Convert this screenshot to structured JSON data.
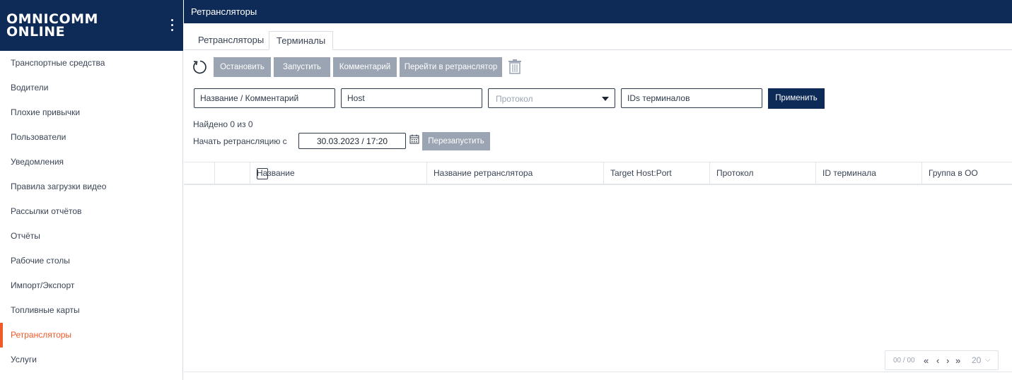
{
  "brand": {
    "line1": "OMNICOMM",
    "line2": "ONLINE"
  },
  "sidebar": {
    "items": [
      {
        "label": "Транспортные средства"
      },
      {
        "label": "Водители"
      },
      {
        "label": "Плохие привычки"
      },
      {
        "label": "Пользователи"
      },
      {
        "label": "Уведомления"
      },
      {
        "label": "Правила загрузки видео"
      },
      {
        "label": "Рассылки отчётов"
      },
      {
        "label": "Отчёты"
      },
      {
        "label": "Рабочие столы"
      },
      {
        "label": "Импорт/Экспорт"
      },
      {
        "label": "Топливные карты"
      },
      {
        "label": "Ретрансляторы",
        "active": true
      },
      {
        "label": "Услуги"
      }
    ]
  },
  "header": {
    "title": "Ретрансляторы"
  },
  "tabs": [
    {
      "label": "Ретрансляторы"
    },
    {
      "label": "Терминалы",
      "active": true
    }
  ],
  "toolbar": {
    "stop": "Остановить",
    "start": "Запустить",
    "comment": "Комментарий",
    "goto": "Перейти в ретранслятор"
  },
  "filters": {
    "name": "Название / Комментарий",
    "host": "Host",
    "protocol_placeholder": "Протокол",
    "ids": "IDs терминалов",
    "apply": "Применить"
  },
  "status": {
    "found": "Найдено 0 из 0"
  },
  "restart": {
    "label": "Начать ретрансляцию с",
    "date": "30.03.2023 / 17:20",
    "button": "Перезапустить"
  },
  "table": {
    "columns": [
      "Название",
      "Название ретранслятора",
      "Target Host:Port",
      "Протокол",
      "ID терминала",
      "Группа в ОО"
    ],
    "rows": []
  },
  "pager": {
    "current": "00",
    "separator": "/",
    "total": "00",
    "page_size": "20"
  },
  "colors": {
    "navy": "#0e2a56",
    "accent": "#f05a28",
    "disabled_button": "#9aa4b2"
  }
}
